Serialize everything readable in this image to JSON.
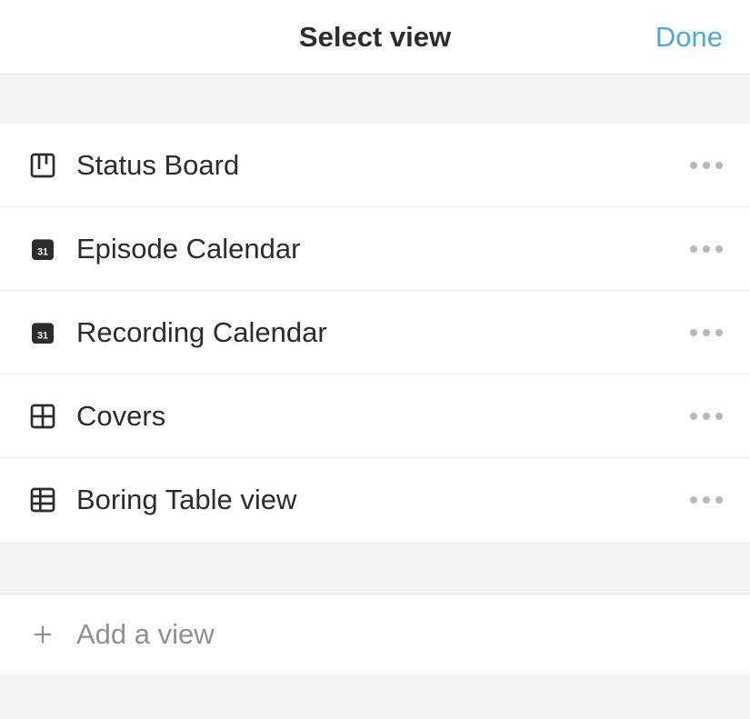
{
  "header": {
    "title": "Select view",
    "done_label": "Done"
  },
  "views": [
    {
      "label": "Status Board",
      "icon": "board"
    },
    {
      "label": "Episode Calendar",
      "icon": "calendar"
    },
    {
      "label": "Recording Calendar",
      "icon": "calendar"
    },
    {
      "label": "Covers",
      "icon": "gallery"
    },
    {
      "label": "Boring Table view",
      "icon": "table"
    }
  ],
  "add_view": {
    "label": "Add a view"
  }
}
